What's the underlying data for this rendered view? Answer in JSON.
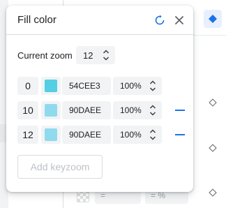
{
  "popup": {
    "title": "Fill color",
    "current_zoom_label": "Current zoom",
    "current_zoom_value": "12",
    "add_button_label": "Add keyzoom",
    "add_button_disabled": true
  },
  "keyzooms": [
    {
      "zoom": "0",
      "color": "#54CEE3",
      "hex": "54CEE3",
      "opacity": "100%",
      "removable": false
    },
    {
      "zoom": "10",
      "color": "#90DAEE",
      "hex": "90DAEE",
      "opacity": "100%",
      "removable": true
    },
    {
      "zoom": "12",
      "color": "#90DAEE",
      "hex": "90DAEE",
      "opacity": "100%",
      "removable": true
    }
  ],
  "background": {
    "bottom_field_1": "=",
    "bottom_field_2": "= %"
  },
  "icons": {
    "reset": "reset-icon",
    "close": "close-icon",
    "stepper": "up-down-chevron-icon",
    "remove": "minus-icon",
    "symbol": "diamond-icon"
  },
  "colors": {
    "accent": "#1a73e8",
    "field_bg": "#f1f3f4",
    "border": "#dadce0"
  }
}
